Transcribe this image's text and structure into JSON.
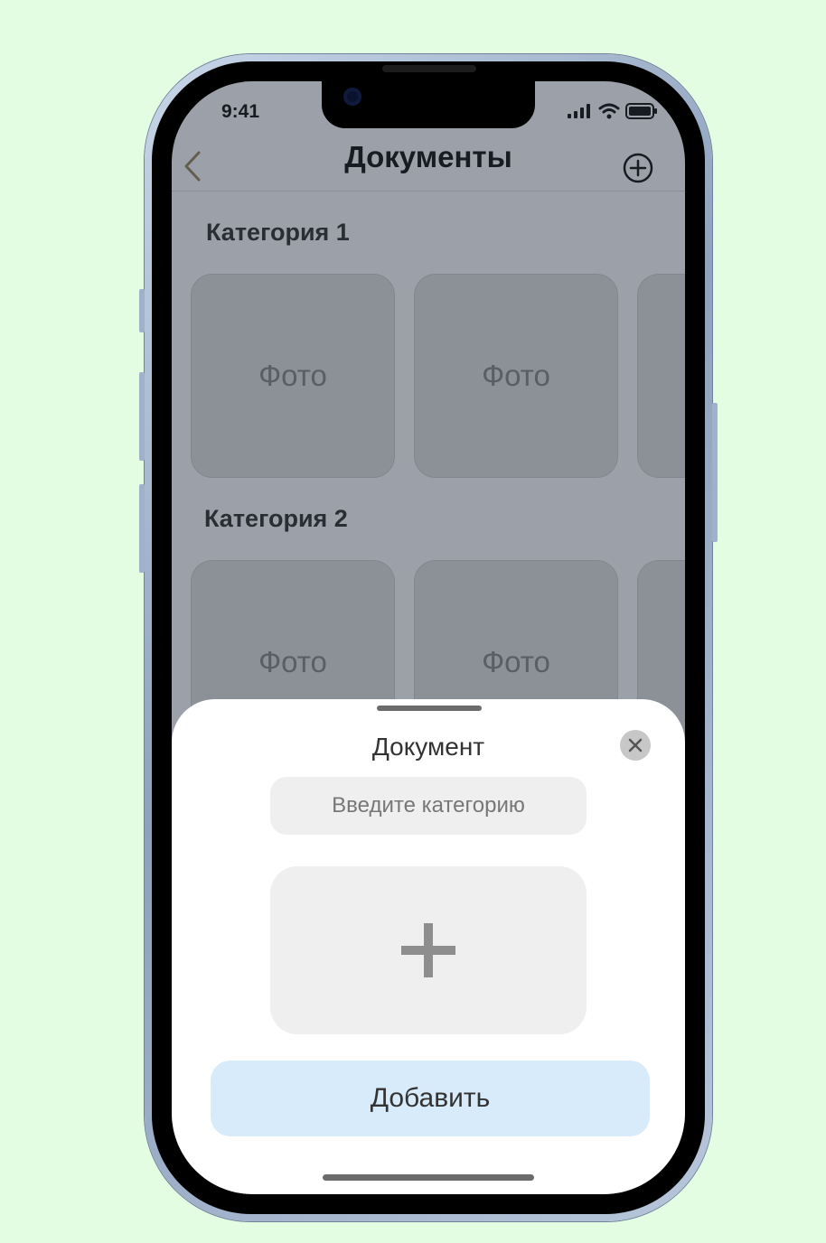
{
  "colors": {
    "background": "#e3fde3",
    "accent_button": "#d8ebfa",
    "input_bg": "#efefef"
  },
  "status_bar": {
    "time": "9:41",
    "icons": [
      "cellular-icon",
      "wifi-icon",
      "battery-icon"
    ]
  },
  "nav": {
    "title": "Документы",
    "back_icon": "chevron-left-icon",
    "add_icon": "plus-circle-icon"
  },
  "categories": [
    {
      "title": "Категория 1",
      "photos": [
        "Фото",
        "Фото",
        ""
      ]
    },
    {
      "title": "Категория 2",
      "photos": [
        "Фото",
        "Фото",
        ""
      ]
    }
  ],
  "sheet": {
    "title": "Документ",
    "close_icon": "close-icon",
    "category_placeholder": "Введите категорию",
    "add_photo_icon": "plus-icon",
    "submit_label": "Добавить"
  }
}
